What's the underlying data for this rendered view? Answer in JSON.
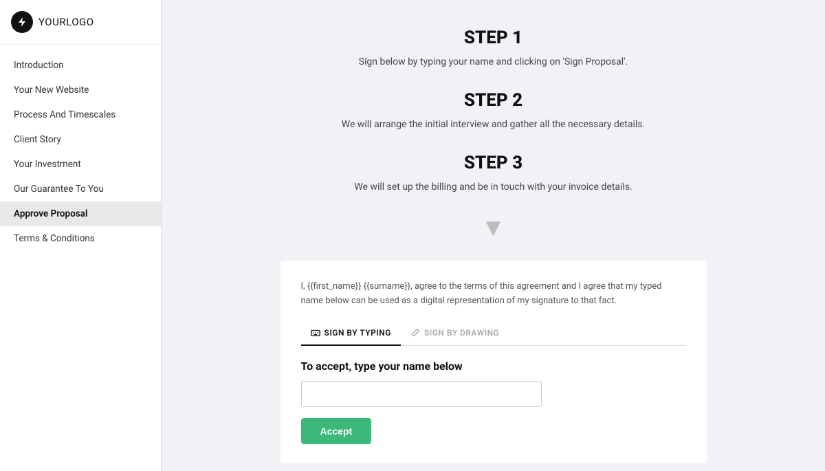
{
  "logo": {
    "icon_label": "lightning-icon",
    "text_bold": "YOUR",
    "text_normal": "LOGO"
  },
  "sidebar": {
    "items": [
      {
        "id": "introduction",
        "label": "Introduction",
        "active": false
      },
      {
        "id": "your-new-website",
        "label": "Your New Website",
        "active": false
      },
      {
        "id": "process-and-timescales",
        "label": "Process And Timescales",
        "active": false
      },
      {
        "id": "client-story",
        "label": "Client Story",
        "active": false
      },
      {
        "id": "your-investment",
        "label": "Your Investment",
        "active": false
      },
      {
        "id": "our-guarantee",
        "label": "Our Guarantee To You",
        "active": false
      },
      {
        "id": "approve-proposal",
        "label": "Approve Proposal",
        "active": true
      },
      {
        "id": "terms-conditions",
        "label": "Terms & Conditions",
        "active": false
      }
    ]
  },
  "steps": [
    {
      "id": "step1",
      "title": "STEP 1",
      "description": "Sign below by typing your name and clicking on 'Sign Proposal'."
    },
    {
      "id": "step2",
      "title": "STEP 2",
      "description": "We will arrange the initial interview and gather all the necessary details."
    },
    {
      "id": "step3",
      "title": "STEP 3",
      "description": "We will set up the billing and be in touch with your invoice details."
    }
  ],
  "signature": {
    "agree_text": "I, {{first_name}} {{surname}}, agree to the terms of this agreement and I agree that my typed name below can be used as a digital representation of my signature to that fact.",
    "tab_typing_label": "SIGN BY TYPING",
    "tab_drawing_label": "SIGN BY DRAWING",
    "accept_heading": "To accept, type your name below",
    "name_placeholder": "",
    "accept_button_label": "Accept"
  }
}
